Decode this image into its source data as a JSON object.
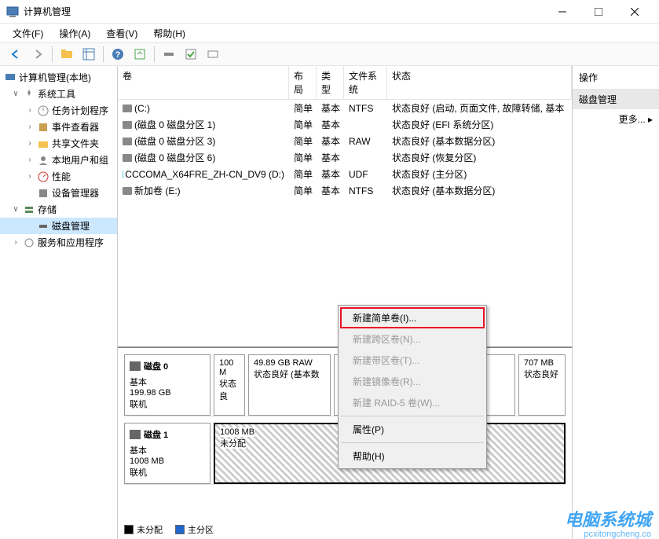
{
  "window": {
    "title": "计算机管理"
  },
  "menubar": {
    "file": "文件(F)",
    "action": "操作(A)",
    "view": "查看(V)",
    "help": "帮助(H)"
  },
  "tree": {
    "root": "计算机管理(本地)",
    "system_tools": "系统工具",
    "task_scheduler": "任务计划程序",
    "event_viewer": "事件查看器",
    "shared_folders": "共享文件夹",
    "local_users": "本地用户和组",
    "performance": "性能",
    "device_manager": "设备管理器",
    "storage": "存储",
    "disk_management": "磁盘管理",
    "services_apps": "服务和应用程序"
  },
  "list": {
    "headers": {
      "volume": "卷",
      "layout": "布局",
      "type": "类型",
      "filesystem": "文件系统",
      "status": "状态"
    },
    "rows": [
      {
        "vol": "(C:)",
        "layout": "简单",
        "type": "基本",
        "fs": "NTFS",
        "status": "状态良好 (启动, 页面文件, 故障转储, 基本",
        "icon": "drive"
      },
      {
        "vol": "(磁盘 0 磁盘分区 1)",
        "layout": "简单",
        "type": "基本",
        "fs": "",
        "status": "状态良好 (EFI 系统分区)",
        "icon": "drive"
      },
      {
        "vol": "(磁盘 0 磁盘分区 3)",
        "layout": "简单",
        "type": "基本",
        "fs": "RAW",
        "status": "状态良好 (基本数据分区)",
        "icon": "drive"
      },
      {
        "vol": "(磁盘 0 磁盘分区 6)",
        "layout": "简单",
        "type": "基本",
        "fs": "",
        "status": "状态良好 (恢复分区)",
        "icon": "drive"
      },
      {
        "vol": "CCCOMA_X64FRE_ZH-CN_DV9 (D:)",
        "layout": "简单",
        "type": "基本",
        "fs": "UDF",
        "status": "状态良好 (主分区)",
        "icon": "cd"
      },
      {
        "vol": "新加卷 (E:)",
        "layout": "简单",
        "type": "基本",
        "fs": "NTFS",
        "status": "状态良好 (基本数据分区)",
        "icon": "drive"
      }
    ]
  },
  "disks": {
    "disk0": {
      "name": "磁盘 0",
      "type": "基本",
      "size": "199.98 GB",
      "status": "联机",
      "partitions": [
        {
          "label": "100 M",
          "sub": "状态良"
        },
        {
          "label": "49.89 GB RAW",
          "sub": "状态良好 (基本数"
        },
        {
          "label": "707 MB",
          "sub": "状态良好"
        }
      ]
    },
    "disk1": {
      "name": "磁盘 1",
      "type": "基本",
      "size": "1008 MB",
      "status": "联机",
      "partitions": [
        {
          "label": "1008 MB",
          "sub": "未分配"
        }
      ]
    }
  },
  "legend": {
    "unallocated": "未分配",
    "primary": "主分区"
  },
  "actions": {
    "header": "操作",
    "subheader": "磁盘管理",
    "more": "更多..."
  },
  "context_menu": {
    "new_simple": "新建简单卷(I)...",
    "new_spanned": "新建跨区卷(N)...",
    "new_striped": "新建带区卷(T)...",
    "new_mirrored": "新建镜像卷(R)...",
    "new_raid5": "新建 RAID-5 卷(W)...",
    "properties": "属性(P)",
    "help": "帮助(H)"
  },
  "watermark": {
    "main": "电脑系统城",
    "sub": "pcxitongcheng.co"
  }
}
